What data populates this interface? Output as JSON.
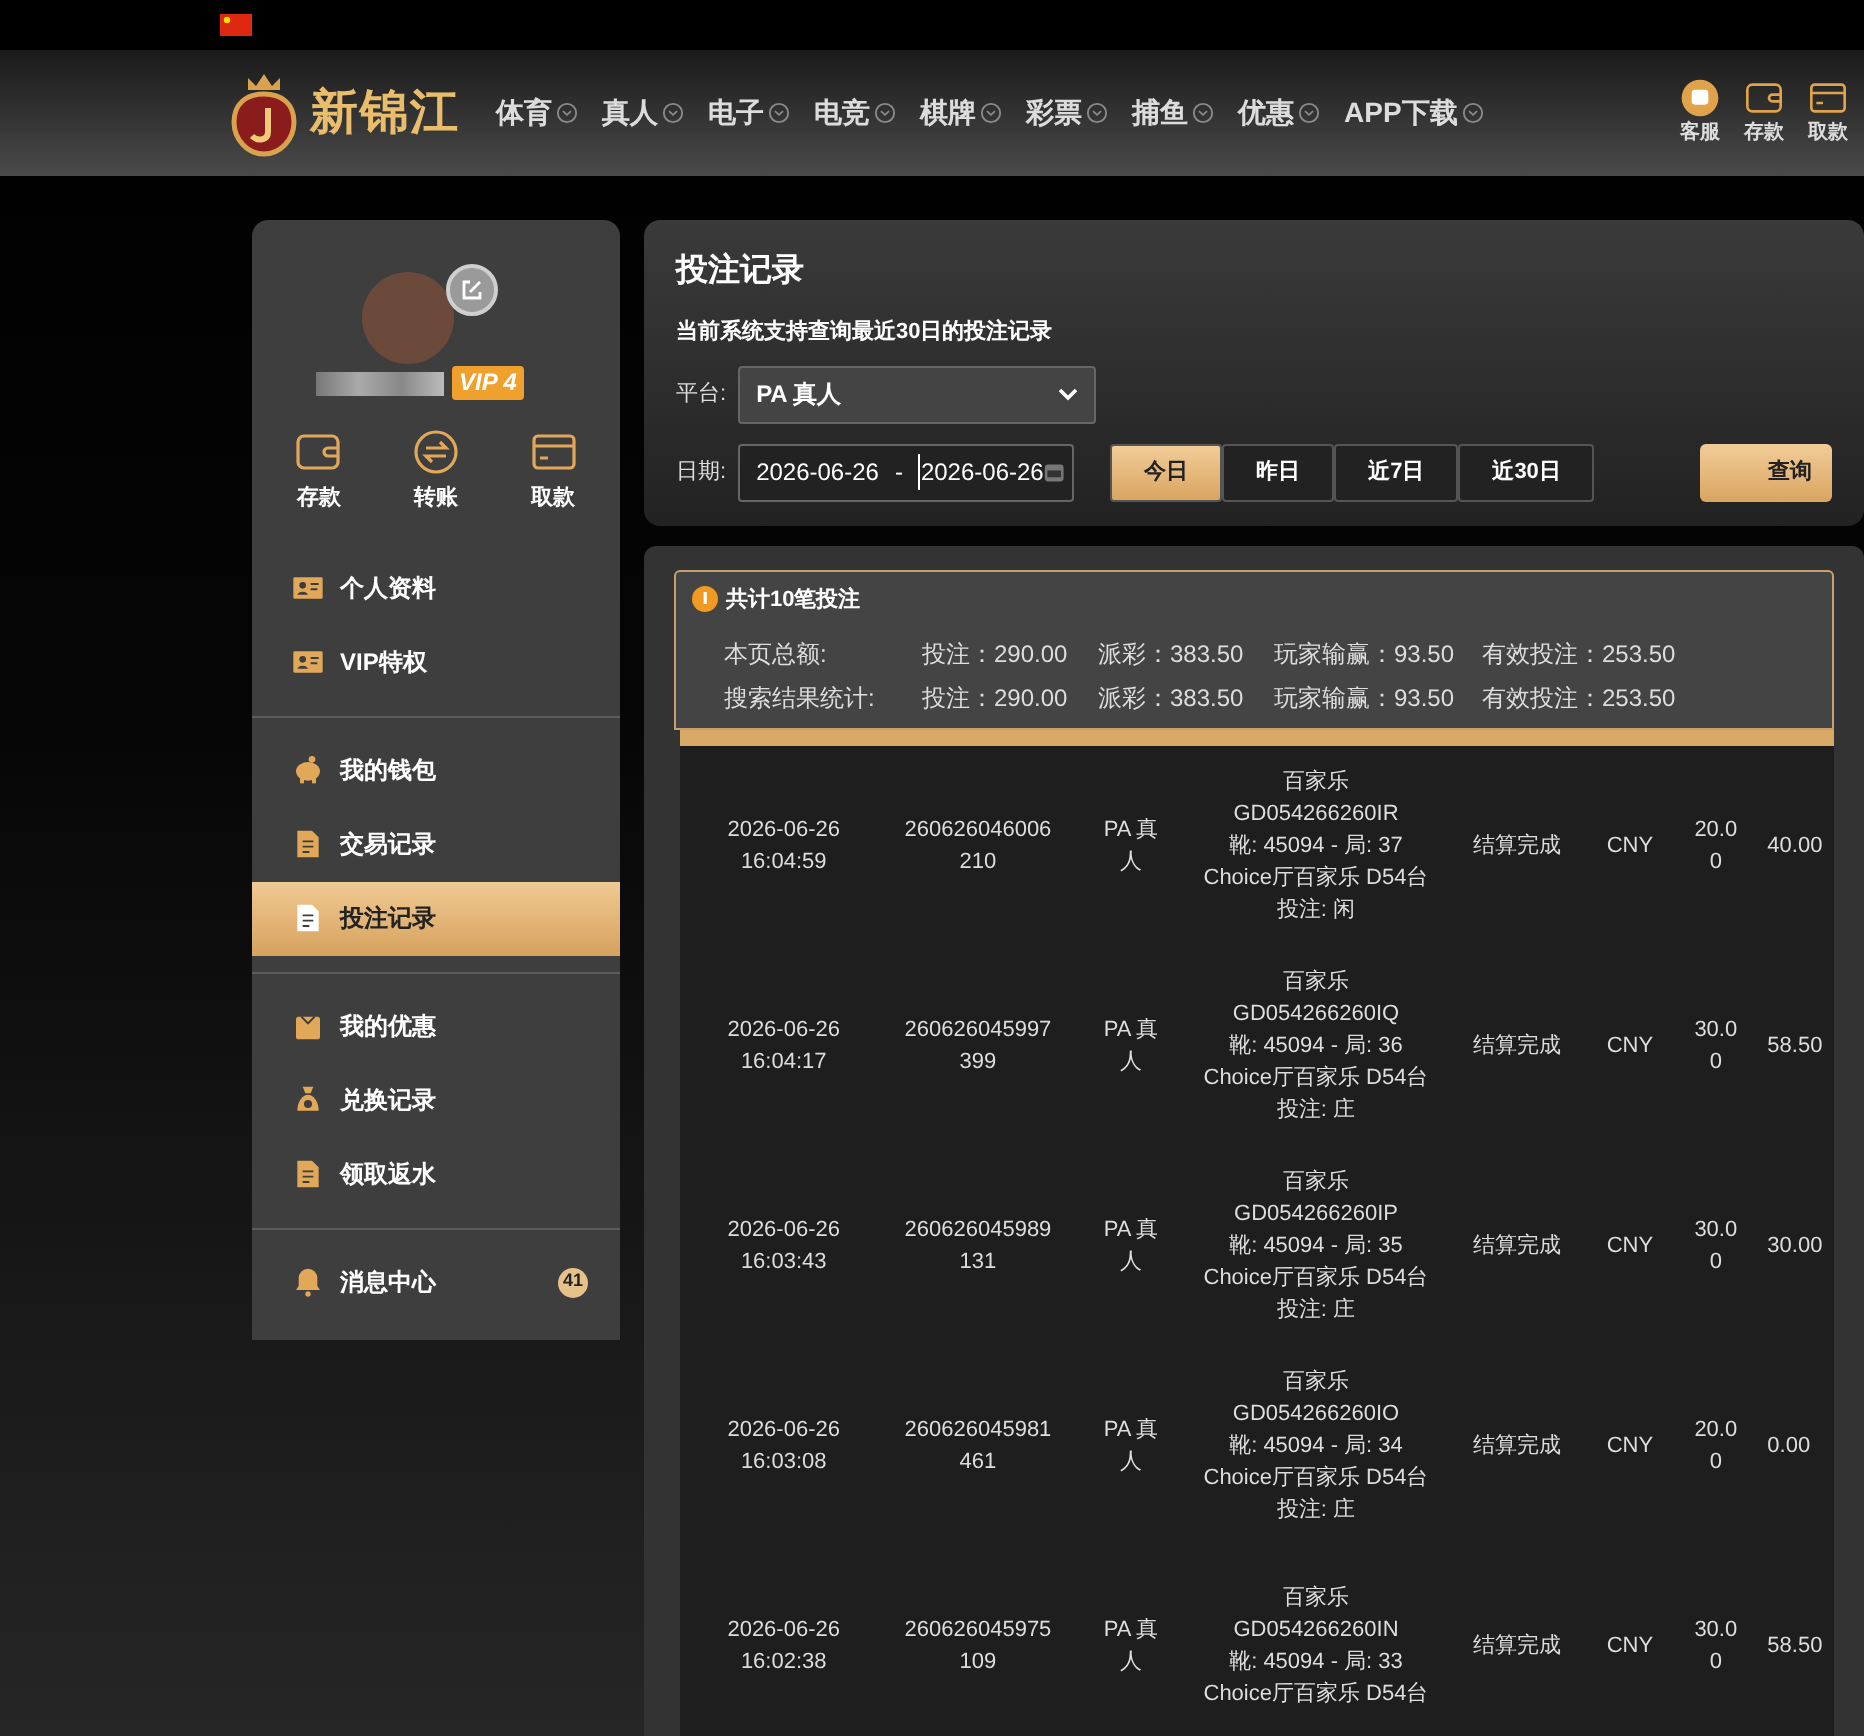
{
  "header": {
    "logo_text": "新锦江",
    "nav": [
      {
        "label": "体育"
      },
      {
        "label": "真人"
      },
      {
        "label": "电子"
      },
      {
        "label": "电竞"
      },
      {
        "label": "棋牌"
      },
      {
        "label": "彩票"
      },
      {
        "label": "捕鱼"
      },
      {
        "label": "优惠"
      },
      {
        "label": "APP下载"
      }
    ],
    "actions": [
      {
        "label": "客服",
        "kind": "chat"
      },
      {
        "label": "存款",
        "kind": "wallet"
      },
      {
        "label": "取款",
        "kind": "card"
      }
    ]
  },
  "sidebar": {
    "vip": "VIP 4",
    "quick_actions": [
      {
        "label": "存款",
        "kind": "wallet"
      },
      {
        "label": "转账",
        "kind": "transfer"
      },
      {
        "label": "取款",
        "kind": "card"
      }
    ],
    "menu_groups": [
      [
        {
          "label": "个人资料",
          "kind": "idcard",
          "selected": false
        },
        {
          "label": "VIP特权",
          "kind": "idcard",
          "selected": false
        }
      ],
      [
        {
          "label": "我的钱包",
          "kind": "piggy",
          "selected": false
        },
        {
          "label": "交易记录",
          "kind": "doc",
          "selected": false
        },
        {
          "label": "投注记录",
          "kind": "doc",
          "selected": true
        }
      ],
      [
        {
          "label": "我的优惠",
          "kind": "bag",
          "selected": false
        },
        {
          "label": "兑换记录",
          "kind": "moneybag",
          "selected": false
        },
        {
          "label": "领取返水",
          "kind": "doc",
          "selected": false
        }
      ],
      [
        {
          "label": "消息中心",
          "kind": "bell",
          "selected": false,
          "badge": "41"
        }
      ]
    ]
  },
  "filter": {
    "title": "投注记录",
    "note": "当前系统支持查询最近30日的投注记录",
    "platform_label": "平台:",
    "platform": "PA 真人",
    "date_label": "日期:",
    "date_from": "2026-06-26",
    "date_separator": "-",
    "date_to": "2026-06-26",
    "ranges": [
      {
        "label": "今日",
        "selected": true
      },
      {
        "label": "昨日",
        "selected": false
      },
      {
        "label": "近7日",
        "selected": false
      },
      {
        "label": "近30日",
        "selected": false
      }
    ],
    "query_button": "查询"
  },
  "summary": {
    "count": "共计10笔投注",
    "rows": [
      {
        "label": "本页总额:",
        "values": [
          "投注：290.00",
          "派彩：383.50",
          "玩家输赢：93.50",
          "有效投注：253.50"
        ]
      },
      {
        "label": "搜索结果统计:",
        "values": [
          "投注：290.00",
          "派彩：383.50",
          "玩家输赢：93.50",
          "有效投注：253.50"
        ]
      }
    ]
  },
  "records": [
    {
      "time": "2026-06-26 16:04:59",
      "id": "260626046006210",
      "platform": "PA 真人",
      "details": [
        "百家乐",
        "GD054266260IR",
        "靴: 45094 - 局: 37",
        "Choice厅百家乐 D54台",
        "投注: 闲"
      ],
      "status": "结算完成",
      "currency": "CNY",
      "amount": "20.00",
      "payout": "40.00"
    },
    {
      "time": "2026-06-26 16:04:17",
      "id": "260626045997399",
      "platform": "PA 真人",
      "details": [
        "百家乐",
        "GD054266260IQ",
        "靴: 45094 - 局: 36",
        "Choice厅百家乐 D54台",
        "投注: 庄"
      ],
      "status": "结算完成",
      "currency": "CNY",
      "amount": "30.00",
      "payout": "58.50"
    },
    {
      "time": "2026-06-26 16:03:43",
      "id": "260626045989131",
      "platform": "PA 真人",
      "details": [
        "百家乐",
        "GD054266260IP",
        "靴: 45094 - 局: 35",
        "Choice厅百家乐 D54台",
        "投注: 庄"
      ],
      "status": "结算完成",
      "currency": "CNY",
      "amount": "30.00",
      "payout": "30.00"
    },
    {
      "time": "2026-06-26 16:03:08",
      "id": "260626045981461",
      "platform": "PA 真人",
      "details": [
        "百家乐",
        "GD054266260IO",
        "靴: 45094 - 局: 34",
        "Choice厅百家乐 D54台",
        "投注: 庄"
      ],
      "status": "结算完成",
      "currency": "CNY",
      "amount": "20.00",
      "payout": "0.00"
    },
    {
      "time": "2026-06-26 16:02:38",
      "id": "260626045975109",
      "platform": "PA 真人",
      "details": [
        "百家乐",
        "GD054266260IN",
        "靴: 45094 - 局: 33",
        "Choice厅百家乐 D54台"
      ],
      "status": "结算完成",
      "currency": "CNY",
      "amount": "30.00",
      "payout": "58.50"
    }
  ]
}
